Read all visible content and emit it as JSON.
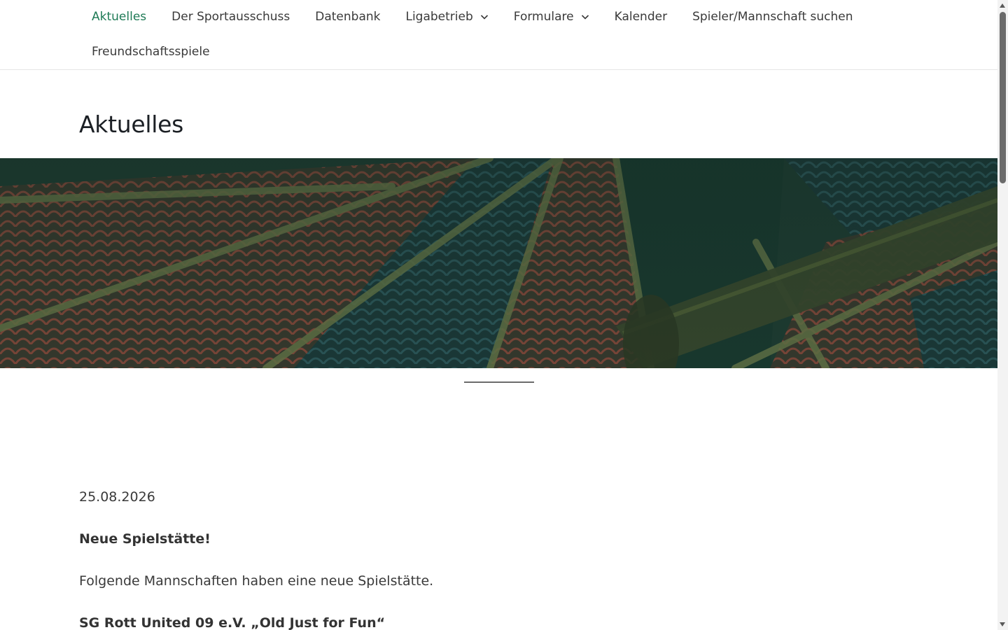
{
  "nav": {
    "items": [
      {
        "label": "Aktuelles",
        "active": true
      },
      {
        "label": "Der Sportausschuss"
      },
      {
        "label": "Datenbank"
      },
      {
        "label": "Ligabetrieb",
        "dropdown": true
      },
      {
        "label": "Formulare",
        "dropdown": true
      },
      {
        "label": "Kalender"
      },
      {
        "label": "Spieler/Mannschaft suchen"
      },
      {
        "label": "Freundschaftsspiele"
      }
    ]
  },
  "page": {
    "title": "Aktuelles"
  },
  "post": {
    "date": "25.08.2026",
    "heading": "Neue Spielstätte!",
    "intro": "Folgende Mannschaften haben eine neue Spielstätte.",
    "team": "SG Rott United 09 e.V. „Old Just for Fun“"
  },
  "colors": {
    "accent": "#1e7a55",
    "text": "#3a3a3a",
    "hero_overlay": "#1d3b2f"
  }
}
